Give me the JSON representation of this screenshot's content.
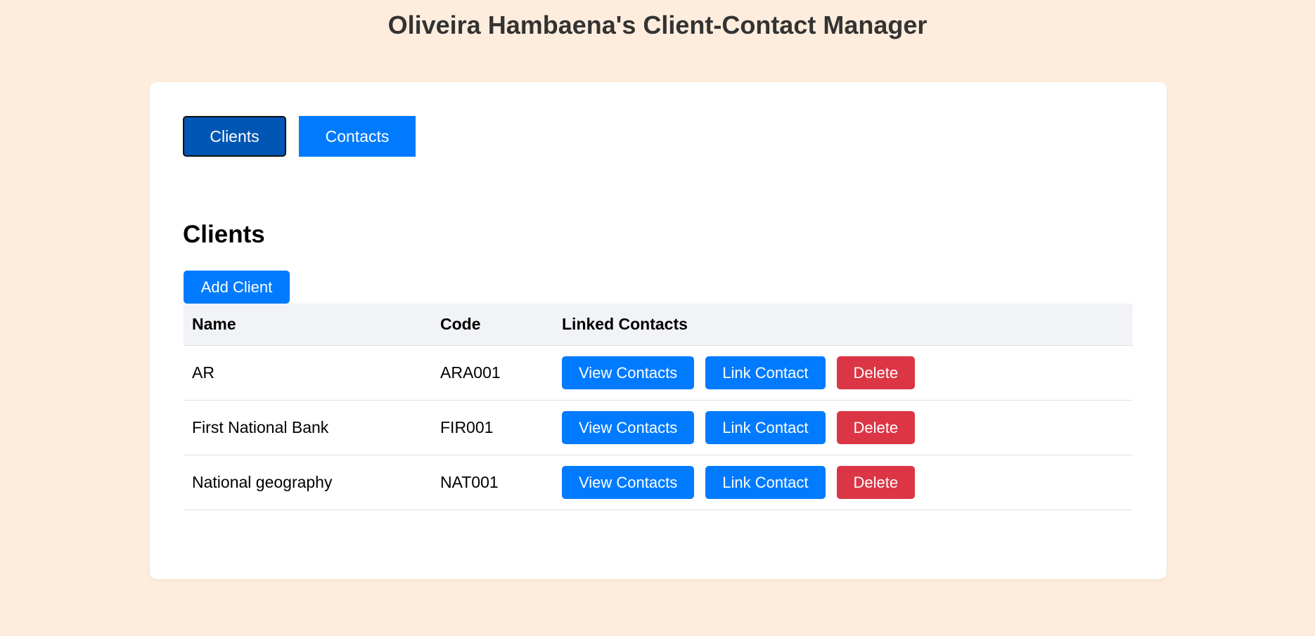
{
  "app": {
    "title": "Oliveira Hambaena's Client-Contact Manager"
  },
  "tabs": [
    {
      "label": "Clients",
      "active": true
    },
    {
      "label": "Contacts",
      "active": false
    }
  ],
  "section": {
    "title": "Clients",
    "add_button": "Add Client"
  },
  "table": {
    "headers": [
      "Name",
      "Code",
      "Linked Contacts"
    ],
    "rows": [
      {
        "name": "AR",
        "code": "ARA001"
      },
      {
        "name": "First National Bank",
        "code": "FIR001"
      },
      {
        "name": "National geography",
        "code": "NAT001"
      }
    ],
    "actions": {
      "view": "View Contacts",
      "link": "Link Contact",
      "delete": "Delete"
    }
  },
  "colors": {
    "background": "#feeddd",
    "primary": "#007bff",
    "primary_active": "#0056b3",
    "danger": "#dc3545"
  }
}
